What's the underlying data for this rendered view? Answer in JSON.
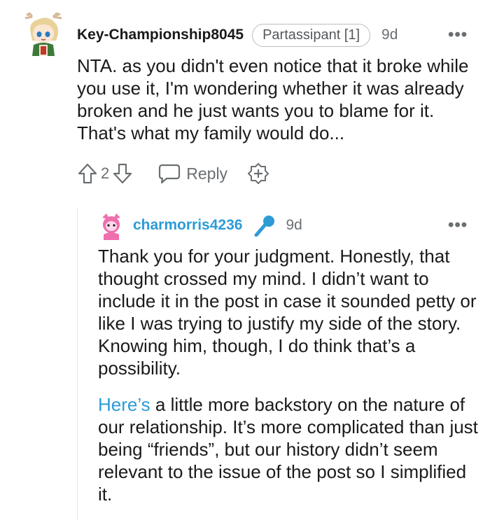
{
  "comment": {
    "username": "Key-Championship8045",
    "flair": "Partassipant [1]",
    "age": "9d",
    "more": "•••",
    "body": "NTA. as you didn't even notice that it broke while you use it, I'm wondering whether it was already broken and he just wants you to blame for it. That's what my family would do...",
    "vote_count": "2",
    "reply_label": "Reply"
  },
  "reply": {
    "username": "charmorris4236",
    "age": "9d",
    "more": "•••",
    "paragraph1": "Thank you for your judgment. Honestly, that thought crossed my mind. I didn’t want to include it in the post in case it sounded petty or like I was trying to justify my side of the story. Knowing him, though, I do think that’s a possibility.",
    "paragraph2_link": "Here’s",
    "paragraph2_rest": " a little more backstory on the nature of our relationship. It’s more complicated than just being “friends”, but our history didn’t seem relevant to the issue of the post so I simplified it."
  },
  "colors": {
    "link_blue": "#2c9bd6",
    "meta_gray": "#6b6f72",
    "text": "#1a1a1b"
  },
  "icons": {
    "upvote": "upvote-arrow-icon",
    "downvote": "downvote-arrow-icon",
    "reply": "speech-bubble-icon",
    "award": "award-plus-icon",
    "mic": "microphone-icon"
  }
}
